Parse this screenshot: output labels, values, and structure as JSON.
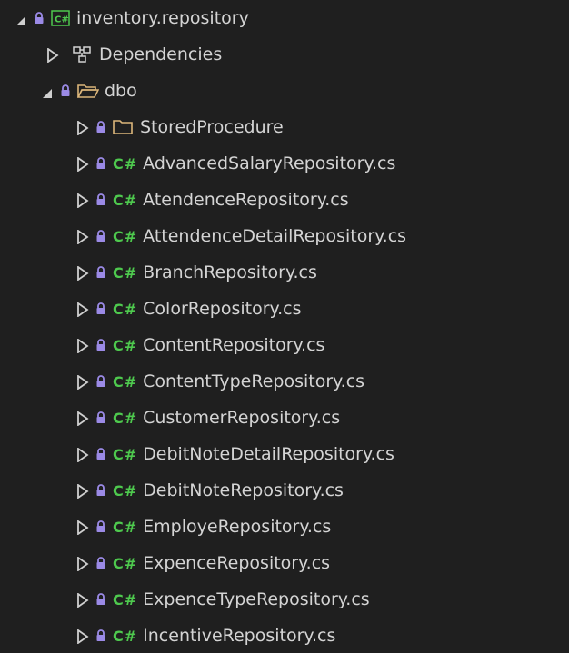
{
  "tree": {
    "project": {
      "name": "inventory.repository",
      "icon": "csharp-project-icon"
    },
    "dependencies": {
      "label": "Dependencies",
      "icon": "dependencies-icon"
    },
    "dbo": {
      "label": "dbo",
      "icon": "open-folder-icon"
    },
    "stored_procedure": {
      "label": "StoredProcedure",
      "icon": "folder-icon"
    },
    "file_badge": "C#",
    "files": [
      "AdvancedSalaryRepository.cs",
      "AtendenceRepository.cs",
      "AttendenceDetailRepository.cs",
      "BranchRepository.cs",
      "ColorRepository.cs",
      "ContentRepository.cs",
      "ContentTypeRepository.cs",
      "CustomerRepository.cs",
      "DebitNoteDetailRepository.cs",
      "DebitNoteRepository.cs",
      "EmployeRepository.cs",
      "ExpenceRepository.cs",
      "ExpenceTypeRepository.cs",
      "IncentiveRepository.cs"
    ]
  },
  "colors": {
    "background": "#1f1f1f",
    "text": "#d4d4d4",
    "lock": "#9b8ae6",
    "csharp_badge": "#4ec94e",
    "folder": "#dcb67a"
  }
}
